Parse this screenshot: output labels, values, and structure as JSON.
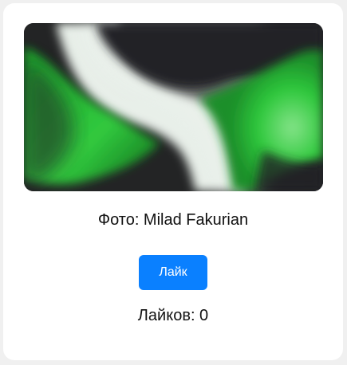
{
  "card": {
    "photo": {
      "alt": "Green and white abstract gradient waves",
      "colors": {
        "dark": "#232425",
        "green": "#2ec83c",
        "light_green": "#7fe083",
        "white_band": "#e8efe9"
      }
    },
    "caption": "Фото: Milad Fakurian",
    "like_button_label": "Лайк",
    "likes_label": "Лайков: 0"
  },
  "colors": {
    "accent": "#0a80ff",
    "background": "#f0f0f0",
    "card": "#ffffff"
  }
}
